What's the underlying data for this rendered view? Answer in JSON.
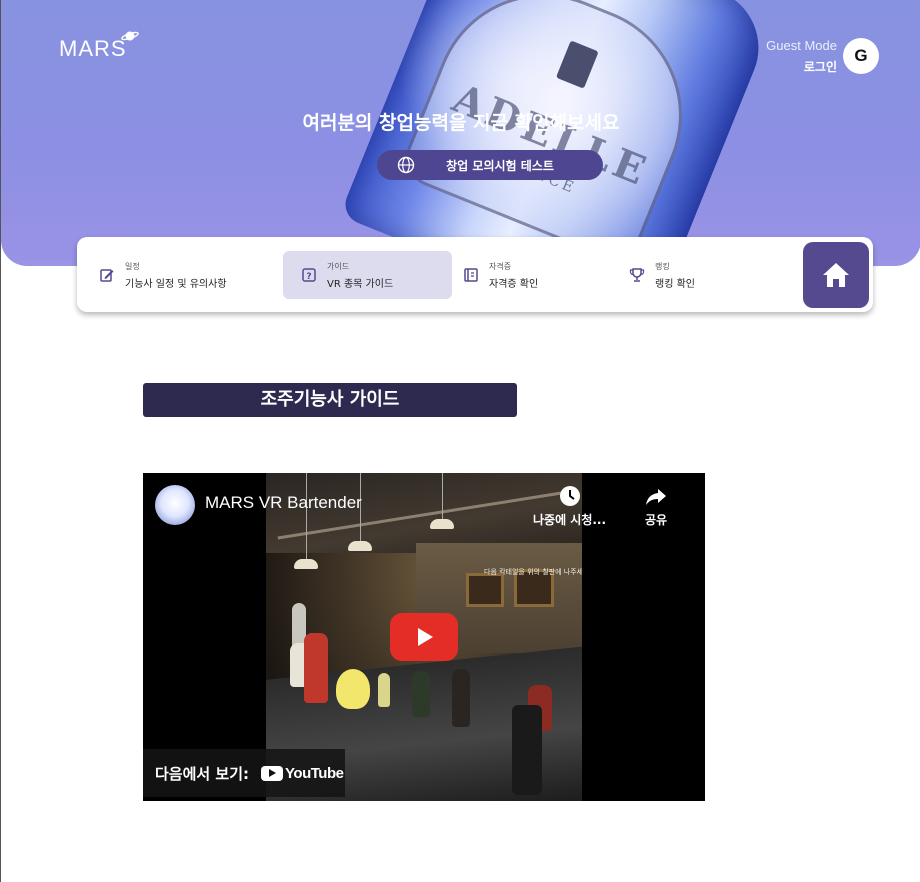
{
  "header": {
    "logo": "MARS",
    "guest_mode": "Guest Mode",
    "login": "로그인",
    "avatar_letter": "G",
    "headline": "여러분의 창업능력을 지금 확인해보세요",
    "cta_label": "창업 모의시험 테스트"
  },
  "nav": {
    "items": [
      {
        "category": "일정",
        "title": "기능사 일정 및 유의사항",
        "icon": "edit-icon",
        "active": false
      },
      {
        "category": "가이드",
        "title": "VR 종목 가이드",
        "icon": "help-icon",
        "active": true
      },
      {
        "category": "자격증",
        "title": "자격증 확인",
        "icon": "certificate-icon",
        "active": false
      },
      {
        "category": "랭킹",
        "title": "랭킹 확인",
        "icon": "trophy-icon",
        "active": false
      }
    ],
    "home_icon": "home-icon"
  },
  "section": {
    "title": "조주기능사 가이드"
  },
  "video": {
    "title": "MARS VR Bartender",
    "watch_later": "나중에 시청...",
    "share": "공유",
    "watch_on": "다음에서 보기:",
    "youtube": "YouTube",
    "overlay_text": "다음 칵테일을 위의 칠판에 나주세요"
  },
  "colors": {
    "hero": "#8c8fe3",
    "accent": "#554a8f",
    "section_title_bg": "#2e2a4f",
    "active_nav": "#dddbee",
    "play_red": "#e52d27"
  }
}
